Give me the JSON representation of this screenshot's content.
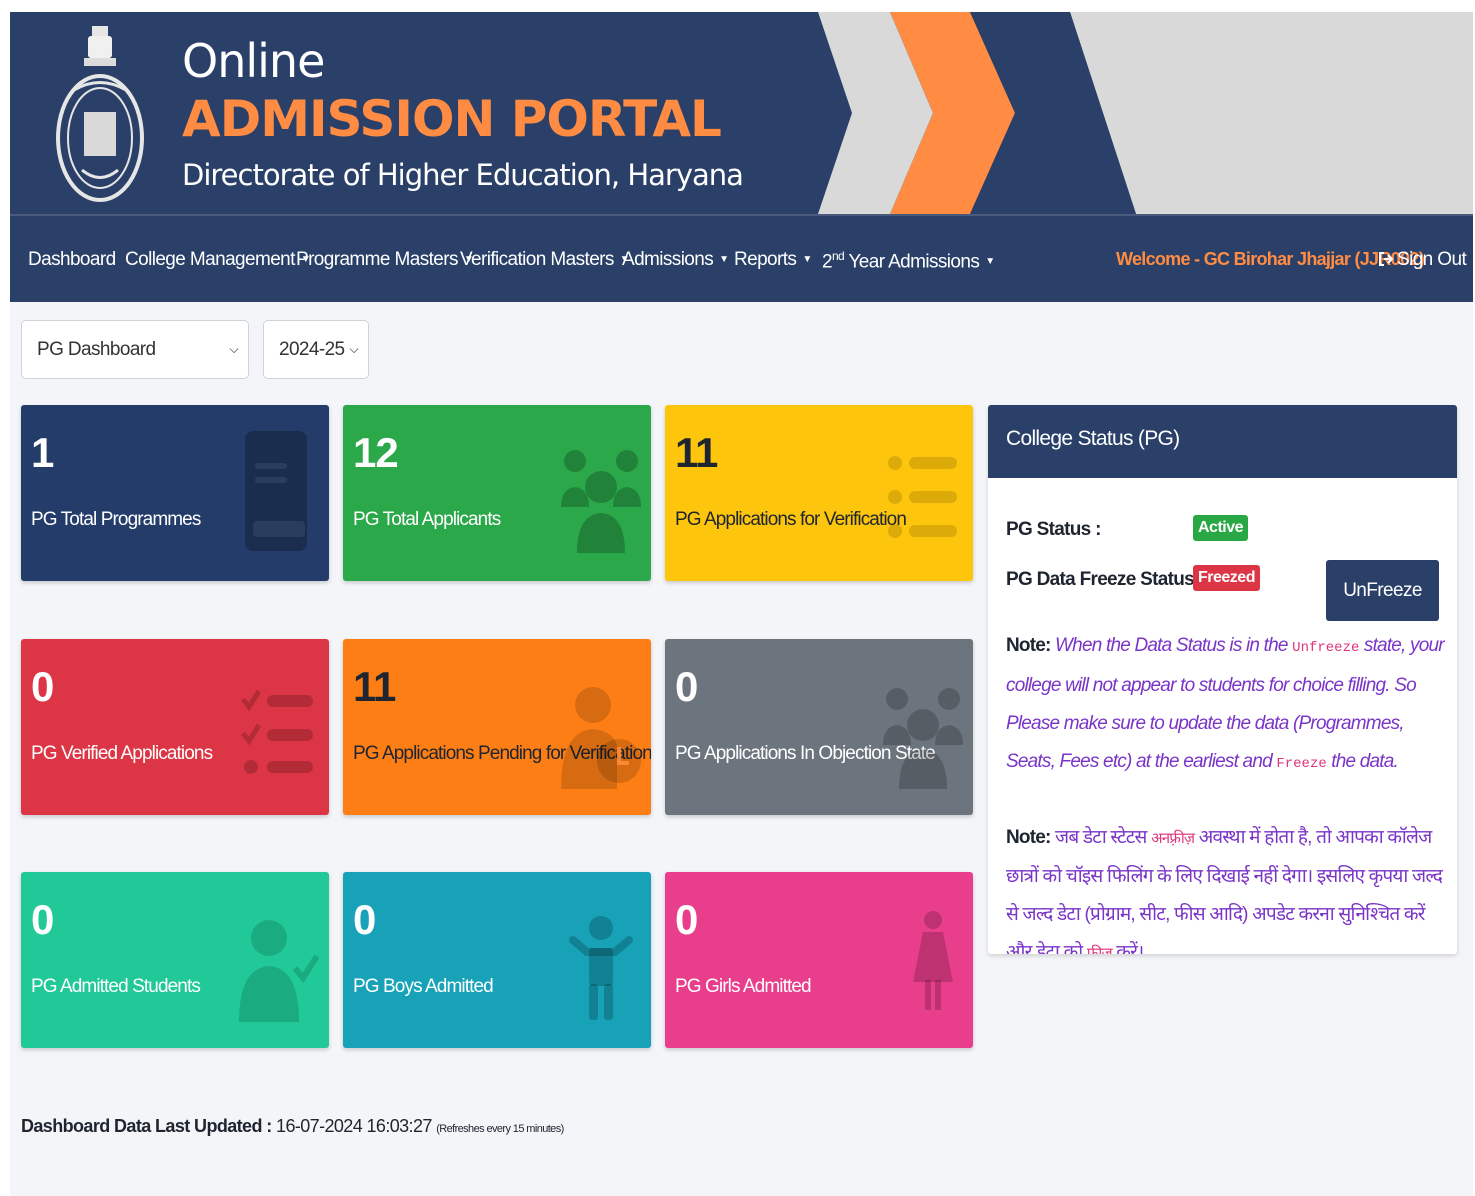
{
  "banner": {
    "title_line1": "Online",
    "title_line2": "ADMISSION PORTAL",
    "title_line3": "Directorate of Higher Education, Haryana",
    "emblem_icon": "haryana-emblem-icon"
  },
  "nav": {
    "items": [
      {
        "label": "Dashboard",
        "has_caret": false
      },
      {
        "label": "College Management",
        "has_caret": true
      },
      {
        "label": "Programme Masters",
        "has_caret": true
      },
      {
        "label": "Verification Masters",
        "has_caret": true
      },
      {
        "label": "Admissions",
        "has_caret": true
      },
      {
        "label": "Reports",
        "has_caret": true
      },
      {
        "label_prefix": "2",
        "label_sup": "nd",
        "label_suffix": " Year Admissions",
        "has_caret": true
      }
    ],
    "welcome": "Welcome - GC Birohar Jhajjar (JJR002)",
    "signout": "Sign Out",
    "signout_icon": "sign-out-icon"
  },
  "filters": {
    "dashboard_select": "PG Dashboard",
    "year_select": "2024-25"
  },
  "cards": [
    {
      "value": "1",
      "label": "PG Total Programmes",
      "color": "#233c6a",
      "icon": "book-icon"
    },
    {
      "value": "12",
      "label": "PG Total Applicants",
      "color": "#2aa84a",
      "icon": "users-icon"
    },
    {
      "value": "11",
      "label": "PG Applications for Verification",
      "color": "#fdc50c",
      "icon": "list-icon"
    },
    {
      "value": "0",
      "label": "PG Verified Applications",
      "color": "#dc3545",
      "icon": "list-check-icon"
    },
    {
      "value": "11",
      "label": "PG Applications Pending for Verification",
      "color": "#fd7e14",
      "icon": "user-clock-icon"
    },
    {
      "value": "0",
      "label": "PG Applications In Objection State",
      "color": "#6c757d",
      "icon": "users-icon"
    },
    {
      "value": "0",
      "label": "PG Admitted Students",
      "color": "#20c997",
      "icon": "user-check-icon"
    },
    {
      "value": "0",
      "label": "PG Boys Admitted",
      "color": "#17a2b8",
      "icon": "child-icon"
    },
    {
      "value": "0",
      "label": "PG Girls Admitted",
      "color": "#e83e8c",
      "icon": "female-icon"
    }
  ],
  "status": {
    "title": "College Status (PG)",
    "pg_status_label": "PG Status :",
    "pg_status_value": "Active",
    "freeze_label": "PG Data Freeze Status :",
    "freeze_value": "Freezed",
    "unfreeze_button": "UnFreeze Data",
    "note_label": "Note:",
    "note_en_1": "When the Data Status is in the ",
    "note_en_code1": "Unfreeze",
    "note_en_2": " state, your college will not appear to students for choice filling. So Please make sure to update the data (Programmes, Seats, Fees etc) at the earliest and ",
    "note_en_code2": "Freeze",
    "note_en_3": " the data.",
    "note_hi_1": "जब डेटा स्टेटस ",
    "note_hi_code1": "अनफ़्रीज़",
    "note_hi_2": " अवस्था में होता है, तो आपका कॉलेज छात्रों को चॉइस फिलिंग के लिए दिखाई नहीं देगा। इसलिए कृपया जल्द से जल्द डेटा (प्रोग्राम, सीट, फीस आदि) अपडेट करना सुनिश्चित करें और डेटा को ",
    "note_hi_code2": "फ़्रीज़",
    "note_hi_3": " करें।",
    "active_color": "#28a745",
    "freezed_color": "#dc3545"
  },
  "footer": {
    "label": "Dashboard Data Last Updated :",
    "timestamp": " 16-07-2024 16:03:27 ",
    "refresh_note": "(Refreshes every 15 minutes)"
  }
}
